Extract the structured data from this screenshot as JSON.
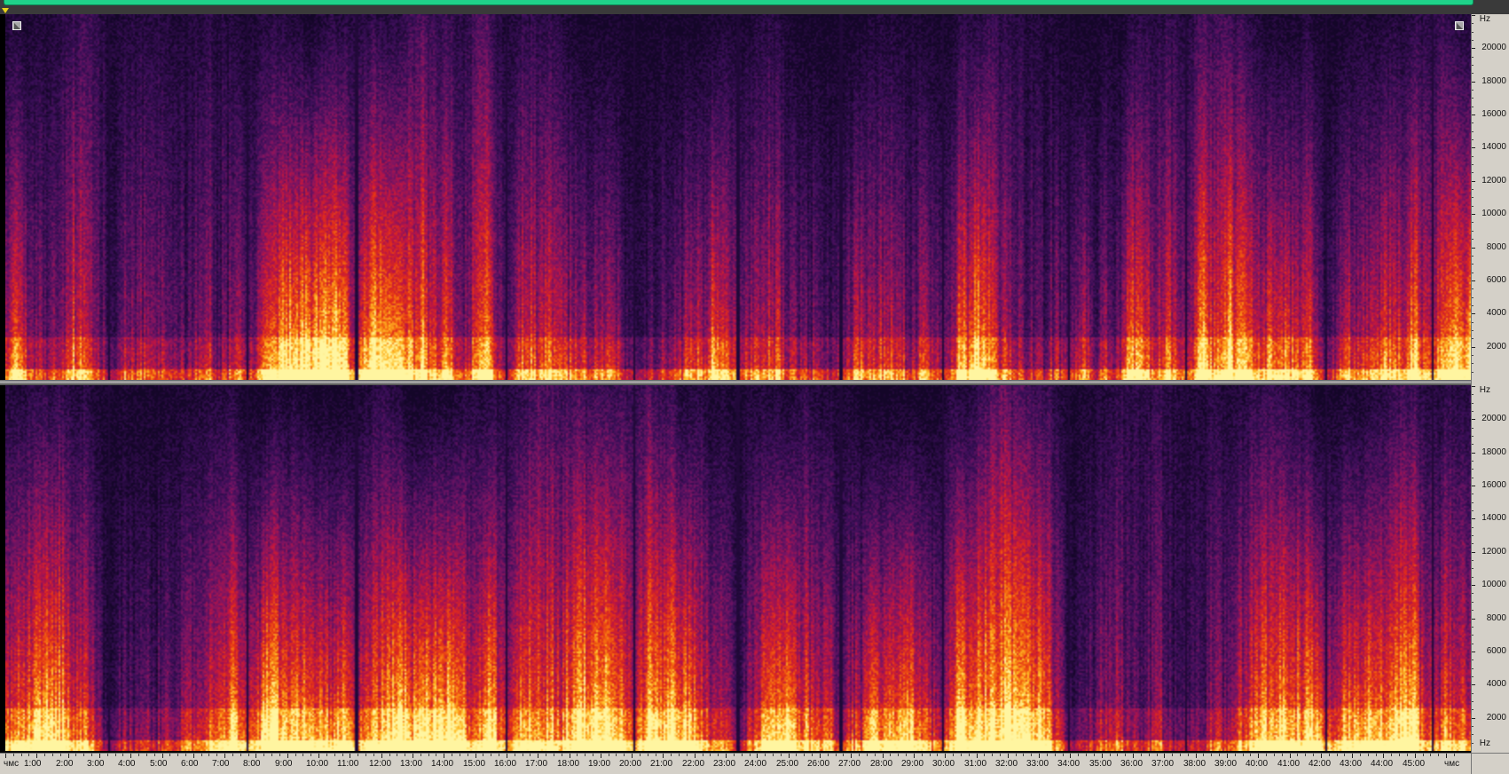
{
  "frequency_axis": {
    "unit_label": "Hz",
    "tick_labels": [
      "20000",
      "18000",
      "16000",
      "14000",
      "12000",
      "10000",
      "8000",
      "6000",
      "4000",
      "2000"
    ],
    "tick_values": [
      20000,
      18000,
      16000,
      14000,
      12000,
      10000,
      8000,
      6000,
      4000,
      2000
    ],
    "max_hz": 22050
  },
  "time_axis": {
    "start_label": "чмс",
    "end_label": "чмс",
    "tick_labels": [
      "1:00",
      "2:00",
      "3:00",
      "4:00",
      "5:00",
      "6:00",
      "7:00",
      "8:00",
      "9:00",
      "10:00",
      "11:00",
      "12:00",
      "13:00",
      "14:00",
      "15:00",
      "16:00",
      "17:00",
      "18:00",
      "19:00",
      "20:00",
      "21:00",
      "22:00",
      "23:00",
      "24:00",
      "25:00",
      "26:00",
      "27:00",
      "28:00",
      "29:00",
      "30:00",
      "31:00",
      "32:00",
      "33:00",
      "34:00",
      "35:00",
      "36:00",
      "37:00",
      "38:00",
      "39:00",
      "40:00",
      "41:00",
      "42:00",
      "43:00",
      "44:00",
      "45:00"
    ],
    "tick_minutes": [
      1,
      2,
      3,
      4,
      5,
      6,
      7,
      8,
      9,
      10,
      11,
      12,
      13,
      14,
      15,
      16,
      17,
      18,
      19,
      20,
      21,
      22,
      23,
      24,
      25,
      26,
      27,
      28,
      29,
      30,
      31,
      32,
      33,
      34,
      35,
      36,
      37,
      38,
      39,
      40,
      41,
      42,
      43,
      44,
      45
    ],
    "total_minutes": 46.45
  },
  "channels": [
    "left",
    "right"
  ],
  "track_boundaries_minutes": [
    3.25,
    7.65,
    11.1,
    15.85,
    19.9,
    23.2,
    26.45,
    29.7,
    33.7,
    37.4,
    41.85,
    45.2
  ],
  "colors": {
    "overview_range": "#1fd389",
    "playhead": "#e8d21a",
    "ruler_bg": "#d4d0c8"
  },
  "icons": {
    "corner_handle": "resize-corner-icon"
  }
}
